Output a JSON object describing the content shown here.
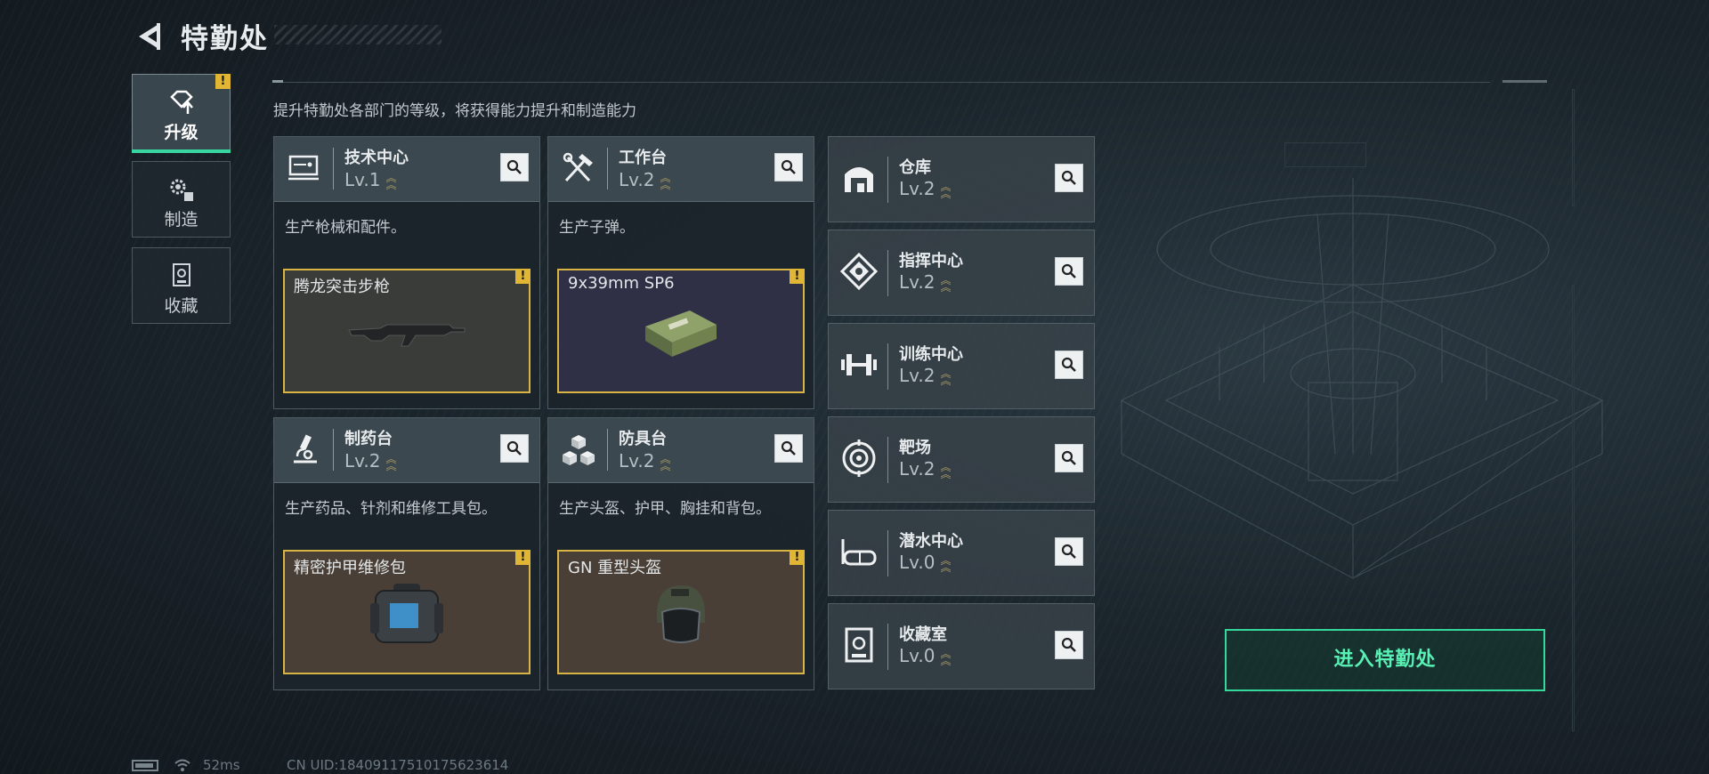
{
  "header": {
    "title": "特勤处"
  },
  "nav": [
    {
      "label": "升级",
      "icon": "upgrade-icon",
      "active": true,
      "alert": "!"
    },
    {
      "label": "制造",
      "icon": "gears-icon",
      "active": false
    },
    {
      "label": "收藏",
      "icon": "collection-icon",
      "active": false
    }
  ],
  "subtitle": "提升特勤处各部门的等级，将获得能力提升和制造能力",
  "cards": [
    {
      "name": "技术中心",
      "level": "Lv.1",
      "desc": "生产枪械和配件。",
      "item": "腾龙突击步枪",
      "alert": "!",
      "icon": "monitor-icon",
      "item_icon": "rifle-icon",
      "item_bg": "#3a3c3a"
    },
    {
      "name": "工作台",
      "level": "Lv.2",
      "desc": "生产子弹。",
      "item": "9x39mm SP6",
      "alert": "!",
      "icon": "tools-icon",
      "item_icon": "ammo-box-icon",
      "item_bg": "#2f2f45"
    },
    {
      "name": "制药台",
      "level": "Lv.2",
      "desc": "生产药品、针剂和维修工具包。",
      "item": "精密护甲维修包",
      "alert": "!",
      "icon": "microscope-icon",
      "item_icon": "repair-kit-icon",
      "item_bg": "#4a3f36"
    },
    {
      "name": "防具台",
      "level": "Lv.2",
      "desc": "生产头盔、护甲、胸挂和背包。",
      "item": "GN 重型头盔",
      "alert": "!",
      "icon": "blocks-icon",
      "item_icon": "helmet-icon",
      "item_bg": "#4a3f36"
    }
  ],
  "rows": [
    {
      "name": "仓库",
      "level": "Lv.2",
      "icon": "warehouse-icon"
    },
    {
      "name": "指挥中心",
      "level": "Lv.2",
      "icon": "command-icon"
    },
    {
      "name": "训练中心",
      "level": "Lv.2",
      "icon": "dumbbell-icon"
    },
    {
      "name": "靶场",
      "level": "Lv.2",
      "icon": "target-icon"
    },
    {
      "name": "潜水中心",
      "level": "Lv.0",
      "icon": "goggles-icon"
    },
    {
      "name": "收藏室",
      "level": "Lv.0",
      "icon": "vault-icon"
    }
  ],
  "enter_button": "进入特勤处",
  "status": {
    "ping": "52ms",
    "uid": "CN UID:18409117510175623614"
  },
  "colors": {
    "accent": "#36d99c",
    "warning": "#e1b634",
    "item_border": "#d8b444"
  },
  "icons": {
    "back": "back-arrow-icon",
    "search": "search-icon",
    "battery": "battery-icon",
    "wifi": "wifi-icon",
    "level_up": "chevron-up-icon"
  }
}
